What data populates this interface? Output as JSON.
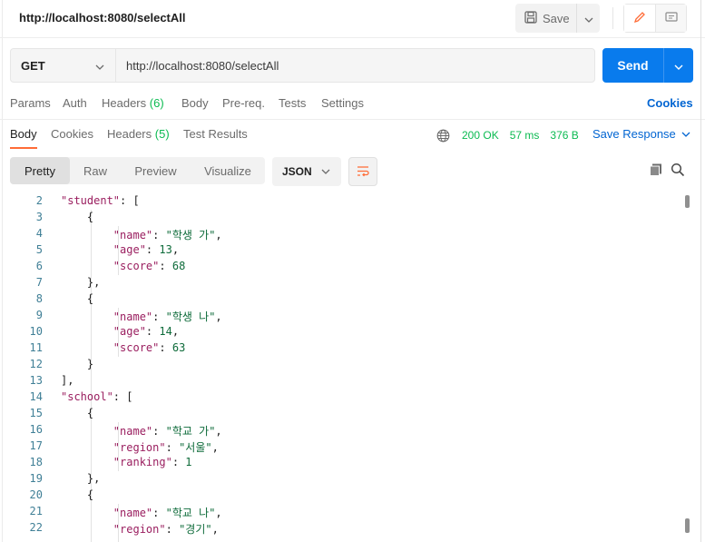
{
  "titlebar": {
    "title": "http://localhost:8080/selectAll",
    "save_label": "Save"
  },
  "request": {
    "method": "GET",
    "url": "http://localhost:8080/selectAll",
    "send_label": "Send"
  },
  "request_tabs": {
    "params": "Params",
    "auth": "Auth",
    "headers": "Headers",
    "headers_count": "(6)",
    "body": "Body",
    "prereq": "Pre-req.",
    "tests": "Tests",
    "settings": "Settings",
    "cookies": "Cookies"
  },
  "response_tabs": {
    "body": "Body",
    "cookies": "Cookies",
    "headers": "Headers",
    "headers_count": "(5)",
    "test_results": "Test Results",
    "status": "200 OK",
    "time": "57 ms",
    "size": "376 B",
    "save_response": "Save Response"
  },
  "view": {
    "pretty": "Pretty",
    "raw": "Raw",
    "preview": "Preview",
    "visualize": "Visualize",
    "format": "JSON"
  },
  "code_lines": [
    {
      "num": "2",
      "text": "    \"student\": ["
    },
    {
      "num": "3",
      "text": "        {"
    },
    {
      "num": "4",
      "text": "            \"name\": \"학생 가\","
    },
    {
      "num": "5",
      "text": "            \"age\": 13,"
    },
    {
      "num": "6",
      "text": "            \"score\": 68"
    },
    {
      "num": "7",
      "text": "        },"
    },
    {
      "num": "8",
      "text": "        {"
    },
    {
      "num": "9",
      "text": "            \"name\": \"학생 나\","
    },
    {
      "num": "10",
      "text": "            \"age\": 14,"
    },
    {
      "num": "11",
      "text": "            \"score\": 63"
    },
    {
      "num": "12",
      "text": "        }"
    },
    {
      "num": "13",
      "text": "    ],"
    },
    {
      "num": "14",
      "text": "    \"school\": ["
    },
    {
      "num": "15",
      "text": "        {"
    },
    {
      "num": "16",
      "text": "            \"name\": \"학교 가\","
    },
    {
      "num": "17",
      "text": "            \"region\": \"서울\","
    },
    {
      "num": "18",
      "text": "            \"ranking\": 1"
    },
    {
      "num": "19",
      "text": "        },"
    },
    {
      "num": "20",
      "text": "        {"
    },
    {
      "num": "21",
      "text": "            \"name\": \"학교 나\","
    },
    {
      "num": "22",
      "text": "            \"region\": \"경기\","
    }
  ]
}
